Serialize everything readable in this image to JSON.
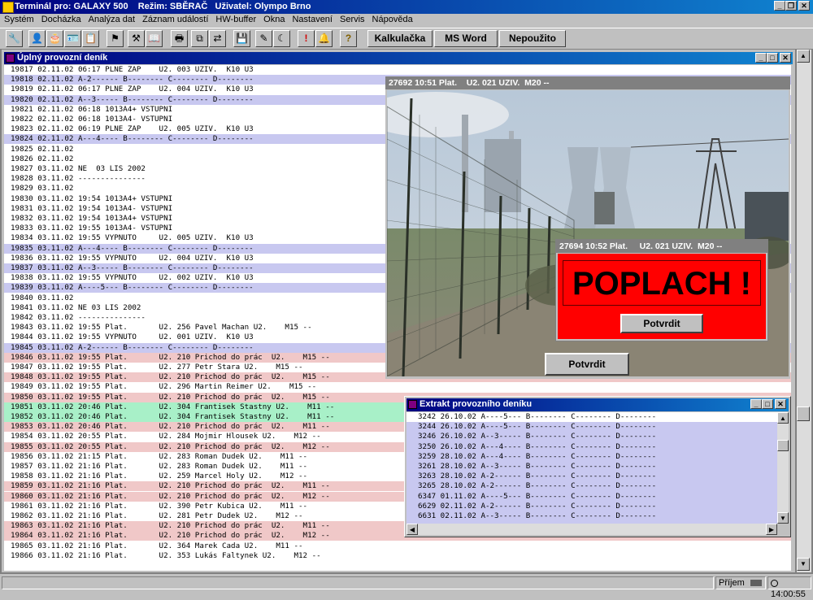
{
  "app": {
    "title": "Terminál pro: GALAXY 500    Režim: SBĚRAČ   Uživatel: Olympo Brno"
  },
  "menu": [
    "Systém",
    "Docházka",
    "Analýza dat",
    "Záznam událostí",
    "HW-buffer",
    "Okna",
    "Nastavení",
    "Servis",
    "Nápověda"
  ],
  "toolbar": {
    "calc_label": "Kalkulačka",
    "word_label": "MS Word",
    "unused_label": "Nepoužito",
    "icons": [
      "wrench-icon",
      "person-icon",
      "cake-icon",
      "card-icon",
      "report-icon",
      "flag-icon",
      "tools-icon",
      "book-icon",
      "printer-icon",
      "copy-icon",
      "transfer-icon",
      "save-icon",
      "pen-icon",
      "moon-icon",
      "alert-icon",
      "bell-icon",
      "help-icon"
    ]
  },
  "journal": {
    "title": "Úplný provozní deník",
    "rows": [
      {
        "t": "19817 02.11.02 06:17 PLNE ZAP    U2. 003 UZIV.  K10 U3",
        "c": ""
      },
      {
        "t": "19818 02.11.02 A-2------ B-------- C-------- D--------",
        "c": "blue"
      },
      {
        "t": "19819 02.11.02 06:17 PLNE ZAP    U2. 004 UZIV.  K10 U3",
        "c": ""
      },
      {
        "t": "19820 02.11.02 A--3----- B-------- C-------- D--------",
        "c": "blue"
      },
      {
        "t": "19821 02.11.02 06:18 1013A4+ VSTUPNI",
        "c": ""
      },
      {
        "t": "19822 02.11.02 06:18 1013A4- VSTUPNI",
        "c": ""
      },
      {
        "t": "19823 02.11.02 06:19 PLNE ZAP    U2. 005 UZIV.  K10 U3",
        "c": ""
      },
      {
        "t": "19824 02.11.02 A---4---- B-------- C-------- D--------",
        "c": "blue"
      },
      {
        "t": "19825 02.11.02",
        "c": ""
      },
      {
        "t": "19826 02.11.02",
        "c": ""
      },
      {
        "t": "19827 03.11.02 NE  03 LIS 2002",
        "c": ""
      },
      {
        "t": "19828 03.11.02 ---------------",
        "c": ""
      },
      {
        "t": "19829 03.11.02",
        "c": ""
      },
      {
        "t": "19830 03.11.02 19:54 1013A4+ VSTUPNI",
        "c": ""
      },
      {
        "t": "19831 03.11.02 19:54 1013A4- VSTUPNI",
        "c": ""
      },
      {
        "t": "19832 03.11.02 19:54 1013A4+ VSTUPNI",
        "c": ""
      },
      {
        "t": "19833 03.11.02 19:55 1013A4- VSTUPNI",
        "c": ""
      },
      {
        "t": "19834 03.11.02 19:55 VYPNUTO     U2. 005 UZIV.  K10 U3",
        "c": ""
      },
      {
        "t": "19835 03.11.02 A---4---- B-------- C-------- D--------",
        "c": "blue"
      },
      {
        "t": "19836 03.11.02 19:55 VYPNUTO     U2. 004 UZIV.  K10 U3",
        "c": ""
      },
      {
        "t": "19837 03.11.02 A--3----- B-------- C-------- D--------",
        "c": "blue"
      },
      {
        "t": "19838 03.11.02 19:55 VYPNUTO     U2. 002 UZIV.  K10 U3",
        "c": ""
      },
      {
        "t": "19839 03.11.02 A----5--- B-------- C-------- D--------",
        "c": "blue"
      },
      {
        "t": "19840 03.11.02",
        "c": ""
      },
      {
        "t": "19841 03.11.02 NE 03 LIS 2002",
        "c": ""
      },
      {
        "t": "19842 03.11.02 ---------------",
        "c": ""
      },
      {
        "t": "19843 03.11.02 19:55 Plat.       U2. 256 Pavel Machan U2.    M15 --",
        "c": ""
      },
      {
        "t": "19844 03.11.02 19:55 VYPNUTO     U2. 001 UZIV.  K10 U3",
        "c": ""
      },
      {
        "t": "19845 03.11.02 A-2------ B-------- C-------- D--------",
        "c": "blue"
      },
      {
        "t": "19846 03.11.02 19:55 Plat.       U2. 210 Prichod do prác  U2.    M15 --",
        "c": "pink"
      },
      {
        "t": "19847 03.11.02 19:55 Plat.       U2. 277 Petr Stara U2.    M15 --",
        "c": ""
      },
      {
        "t": "19848 03.11.02 19:55 Plat.       U2. 210 Prichod do prác  U2.    M15 --",
        "c": "pink"
      },
      {
        "t": "19849 03.11.02 19:55 Plat.       U2. 296 Martin Reimer U2.    M15 --",
        "c": ""
      },
      {
        "t": "19850 03.11.02 19:55 Plat.       U2. 210 Prichod do prác  U2.    M15 --",
        "c": "pink"
      },
      {
        "t": "19851 03.11.02 20:46 Plat.       U2. 304 Frantisek Stastny U2.    M11 --",
        "c": "green"
      },
      {
        "t": "19852 03.11.02 20:46 Plat.       U2. 304 Frantisek Stastny U2.    M11 --",
        "c": "green"
      },
      {
        "t": "19853 03.11.02 20:46 Plat.       U2. 210 Prichod do prác  U2.    M11 --",
        "c": "pink"
      },
      {
        "t": "19854 03.11.02 20:55 Plat.       U2. 284 Mojmir Hlousek U2.    M12 --",
        "c": ""
      },
      {
        "t": "19855 03.11.02 20:55 Plat.       U2. 210 Prichod do prác  U2.    M12 --",
        "c": "pink"
      },
      {
        "t": "19856 03.11.02 21:15 Plat.       U2. 283 Roman Dudek U2.    M11 --",
        "c": ""
      },
      {
        "t": "19857 03.11.02 21:16 Plat.       U2. 283 Roman Dudek U2.    M11 --",
        "c": ""
      },
      {
        "t": "19858 03.11.02 21:16 Plat.       U2. 259 Marcel Holy U2.    M12 --",
        "c": ""
      },
      {
        "t": "19859 03.11.02 21:16 Plat.       U2. 210 Prichod do prác  U2.    M11 --",
        "c": "pink"
      },
      {
        "t": "19860 03.11.02 21:16 Plat.       U2. 210 Prichod do prác  U2.    M12 --",
        "c": "pink"
      },
      {
        "t": "19861 03.11.02 21:16 Plat.       U2. 390 Petr Kubica U2.    M11 --",
        "c": ""
      },
      {
        "t": "19862 03.11.02 21:16 Plat.       U2. 281 Petr Dudek U2.    M12 --",
        "c": ""
      },
      {
        "t": "19863 03.11.02 21:16 Plat.       U2. 210 Prichod do prác  U2.    M11 --",
        "c": "pink"
      },
      {
        "t": "19864 03.11.02 21:16 Plat.       U2. 210 Prichod do prác  U2.    M12 --",
        "c": "pink"
      },
      {
        "t": "19865 03.11.02 21:16 Plat.       U2. 364 Marek Cada U2.    M11 --",
        "c": ""
      },
      {
        "t": "19866 03.11.02 21:16 Plat.       U2. 353 Lukás Faltynek U2.    M12 --",
        "c": ""
      }
    ]
  },
  "camera1": {
    "title": "27692 10:51 Plat.    U2. 021 UZIV.  M20 --",
    "confirm_label": "Potvrdit"
  },
  "alarm": {
    "title": "27694 10:52 Plat.     U2. 021 UZIV.  M20 --",
    "message": "POPLACH !",
    "confirm_label": "Potvrdit"
  },
  "extract": {
    "title": "Extrakt provozního deníku",
    "rows": [
      {
        "t": "3242 26.10.02 A----5--- B-------- C-------- D--------",
        "sel": true
      },
      {
        "t": "3244 26.10.02 A----5--- B-------- C-------- D--------",
        "sel": false
      },
      {
        "t": "3246 26.10.02 A--3----- B-------- C-------- D--------",
        "sel": false
      },
      {
        "t": "3250 26.10.02 A---4---- B-------- C-------- D--------",
        "sel": false
      },
      {
        "t": "3259 28.10.02 A---4---- B-------- C-------- D--------",
        "sel": false
      },
      {
        "t": "3261 28.10.02 A--3----- B-------- C-------- D--------",
        "sel": false
      },
      {
        "t": "3263 28.10.02 A-2------ B-------- C-------- D--------",
        "sel": false
      },
      {
        "t": "3265 28.10.02 A-2------ B-------- C-------- D--------",
        "sel": false
      },
      {
        "t": "6347 01.11.02 A----5--- B-------- C-------- D--------",
        "sel": false
      },
      {
        "t": "6629 02.11.02 A-2------ B-------- C-------- D--------",
        "sel": false
      },
      {
        "t": "6631 02.11.02 A--3----- B-------- C-------- D--------",
        "sel": false
      }
    ]
  },
  "status": {
    "receive_label": "Příjem",
    "time": "14:00:55"
  },
  "colors": {
    "blue_row": "#c8c8f0",
    "pink_row": "#f0c8c8",
    "green_row": "#a8f0c8",
    "alarm_red": "#ff0000"
  }
}
